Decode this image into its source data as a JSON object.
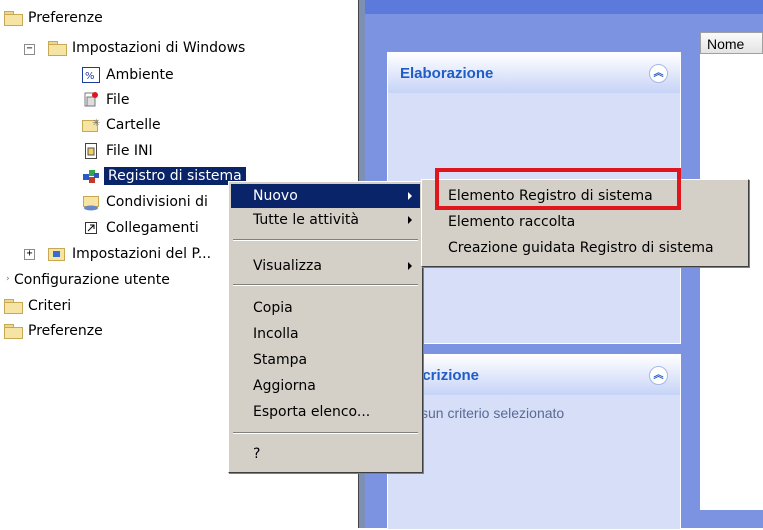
{
  "tree": {
    "items": [
      {
        "label": "Preferenze"
      },
      {
        "label": "Impostazioni di Windows"
      },
      {
        "label": "Ambiente"
      },
      {
        "label": "File"
      },
      {
        "label": "Cartelle"
      },
      {
        "label": "File INI"
      },
      {
        "label": "Registro di sistema"
      },
      {
        "label": "Condivisioni di"
      },
      {
        "label": "Collegamenti"
      },
      {
        "label": "Impostazioni del P..."
      },
      {
        "label": "Configurazione utente"
      },
      {
        "label": "Criteri"
      },
      {
        "label": "Preferenze"
      }
    ],
    "expander_minus": "−",
    "expander_plus": "+"
  },
  "right_pane": {
    "panel1_title": "Elaborazione",
    "panel2_title": "scrizione",
    "panel2_text": "ssun criterio selezionato",
    "column_header": "Nome"
  },
  "context_menu": {
    "items": [
      "Nuovo",
      "Tutte le attività",
      "Visualizza",
      "Copia",
      "Incolla",
      "Stampa",
      "Aggiorna",
      "Esporta elenco...",
      "?"
    ]
  },
  "submenu": {
    "items": [
      "Elemento Registro di sistema",
      "Elemento raccolta",
      "Creazione guidata Registro di sistema"
    ]
  },
  "colors": {
    "highlight": "#0A246A",
    "callout": "#E0161F",
    "pane_blue": "#7B93E0"
  },
  "icons": [
    "folder-icon",
    "environment-icon",
    "file-icon",
    "folder-star-icon",
    "ini-file-icon",
    "registry-icon",
    "share-folder-icon",
    "shortcut-icon",
    "control-panel-folder-icon",
    "chevron-up-icon",
    "submenu-arrow-icon"
  ]
}
